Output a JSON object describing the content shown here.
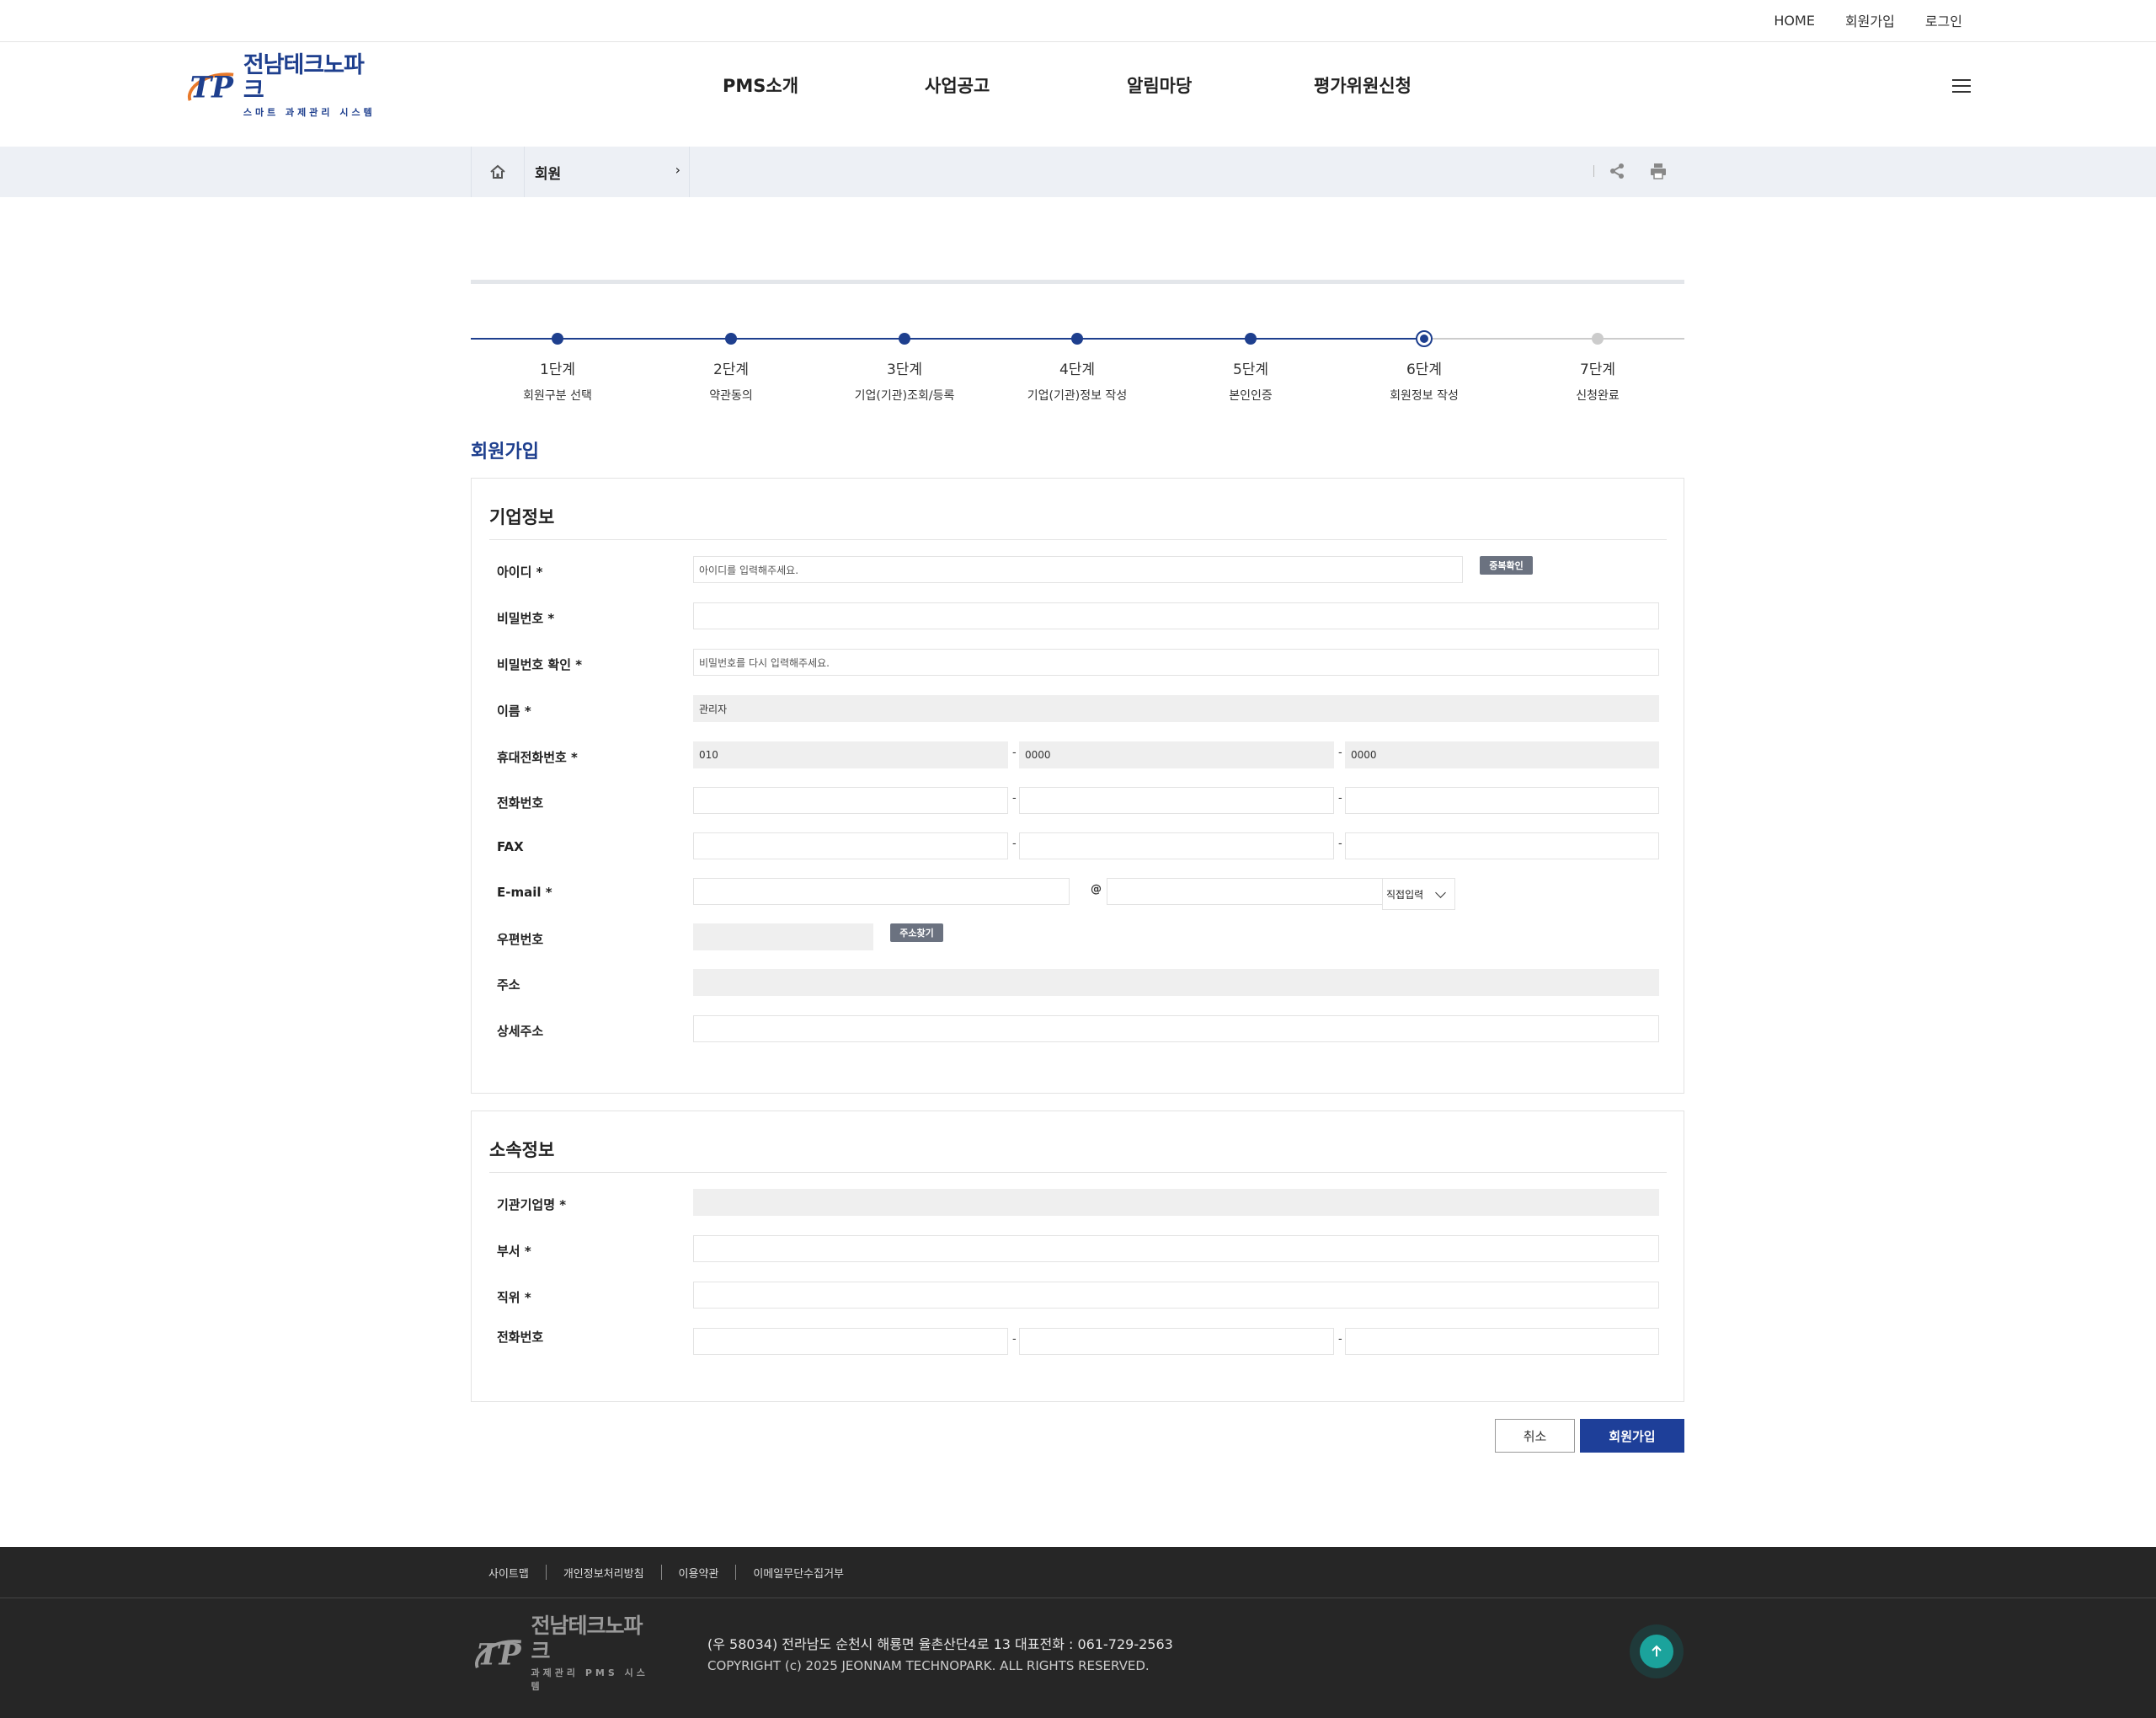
{
  "util_links": [
    "HOME",
    "회원가입",
    "로그인"
  ],
  "logo": {
    "title": "전남테크노파크",
    "subtitle": "스마트 과제관리 시스템"
  },
  "gnb": [
    "PMS소개",
    "사업공고",
    "알림마당",
    "평가위원신청"
  ],
  "location": {
    "depth1": "회원",
    "arrow": "›"
  },
  "steps": [
    {
      "label": "1단계",
      "desc": "회원구분 선택"
    },
    {
      "label": "2단계",
      "desc": "약관동의"
    },
    {
      "label": "3단계",
      "desc": "기업(기관)조회/등록"
    },
    {
      "label": "4단계",
      "desc": "기업(기관)정보 작성"
    },
    {
      "label": "5단계",
      "desc": "본인인증"
    },
    {
      "label": "6단계",
      "desc": "회원정보 작성"
    },
    {
      "label": "7단계",
      "desc": "신청완료"
    }
  ],
  "current_step": 6,
  "page_title": "회원가입",
  "company": {
    "title": "기업정보",
    "id_label": "아이디 *",
    "id_placeholder": "아이디를 입력해주세요.",
    "dup_check": "중복확인",
    "pw_label": "비밀번호 *",
    "pw_confirm_label": "비밀번호 확인 *",
    "pw_confirm_placeholder": "비밀번호를 다시 입력해주세요.",
    "name_label": "이름 *",
    "name_value": "관리자",
    "mobile_label": "휴대전화번호 *",
    "mobile": [
      "010",
      "0000",
      "0000"
    ],
    "phone_label": "전화번호",
    "fax_label": "FAX",
    "email_label": "E-mail *",
    "at": "@",
    "email_select": "직접입력",
    "zip_label": "우편번호",
    "zip_button": "주소찾기",
    "addr_label": "주소",
    "addr_detail_label": "상세주소",
    "dash": "-"
  },
  "affiliation": {
    "title": "소속정보",
    "org_label": "기관기업명 *",
    "dept_label": "부서 *",
    "position_label": "직위 *",
    "phone_label": "전화번호"
  },
  "buttons": {
    "cancel": "취소",
    "join": "회원가입"
  },
  "footer": {
    "links": [
      "사이트맵",
      "개인정보처리방침",
      "이용약관",
      "이메일무단수집거부"
    ],
    "logo_title": "전남테크노파크",
    "logo_subtitle": "과제관리 PMS 시스템",
    "address": "(우 58034) 전라남도 순천시 해룡면 율촌산단4로 13   대표전화 : 061-729-2563",
    "copyright": "COPYRIGHT (c) 2025 JEONNAM TECHNOPARK. ALL RIGHTS RESERVED."
  },
  "colors": {
    "brand": "#1e3f8e",
    "button_primary": "#1e3f99",
    "footer_bg": "#262626",
    "top_button": "#1ba39c"
  }
}
